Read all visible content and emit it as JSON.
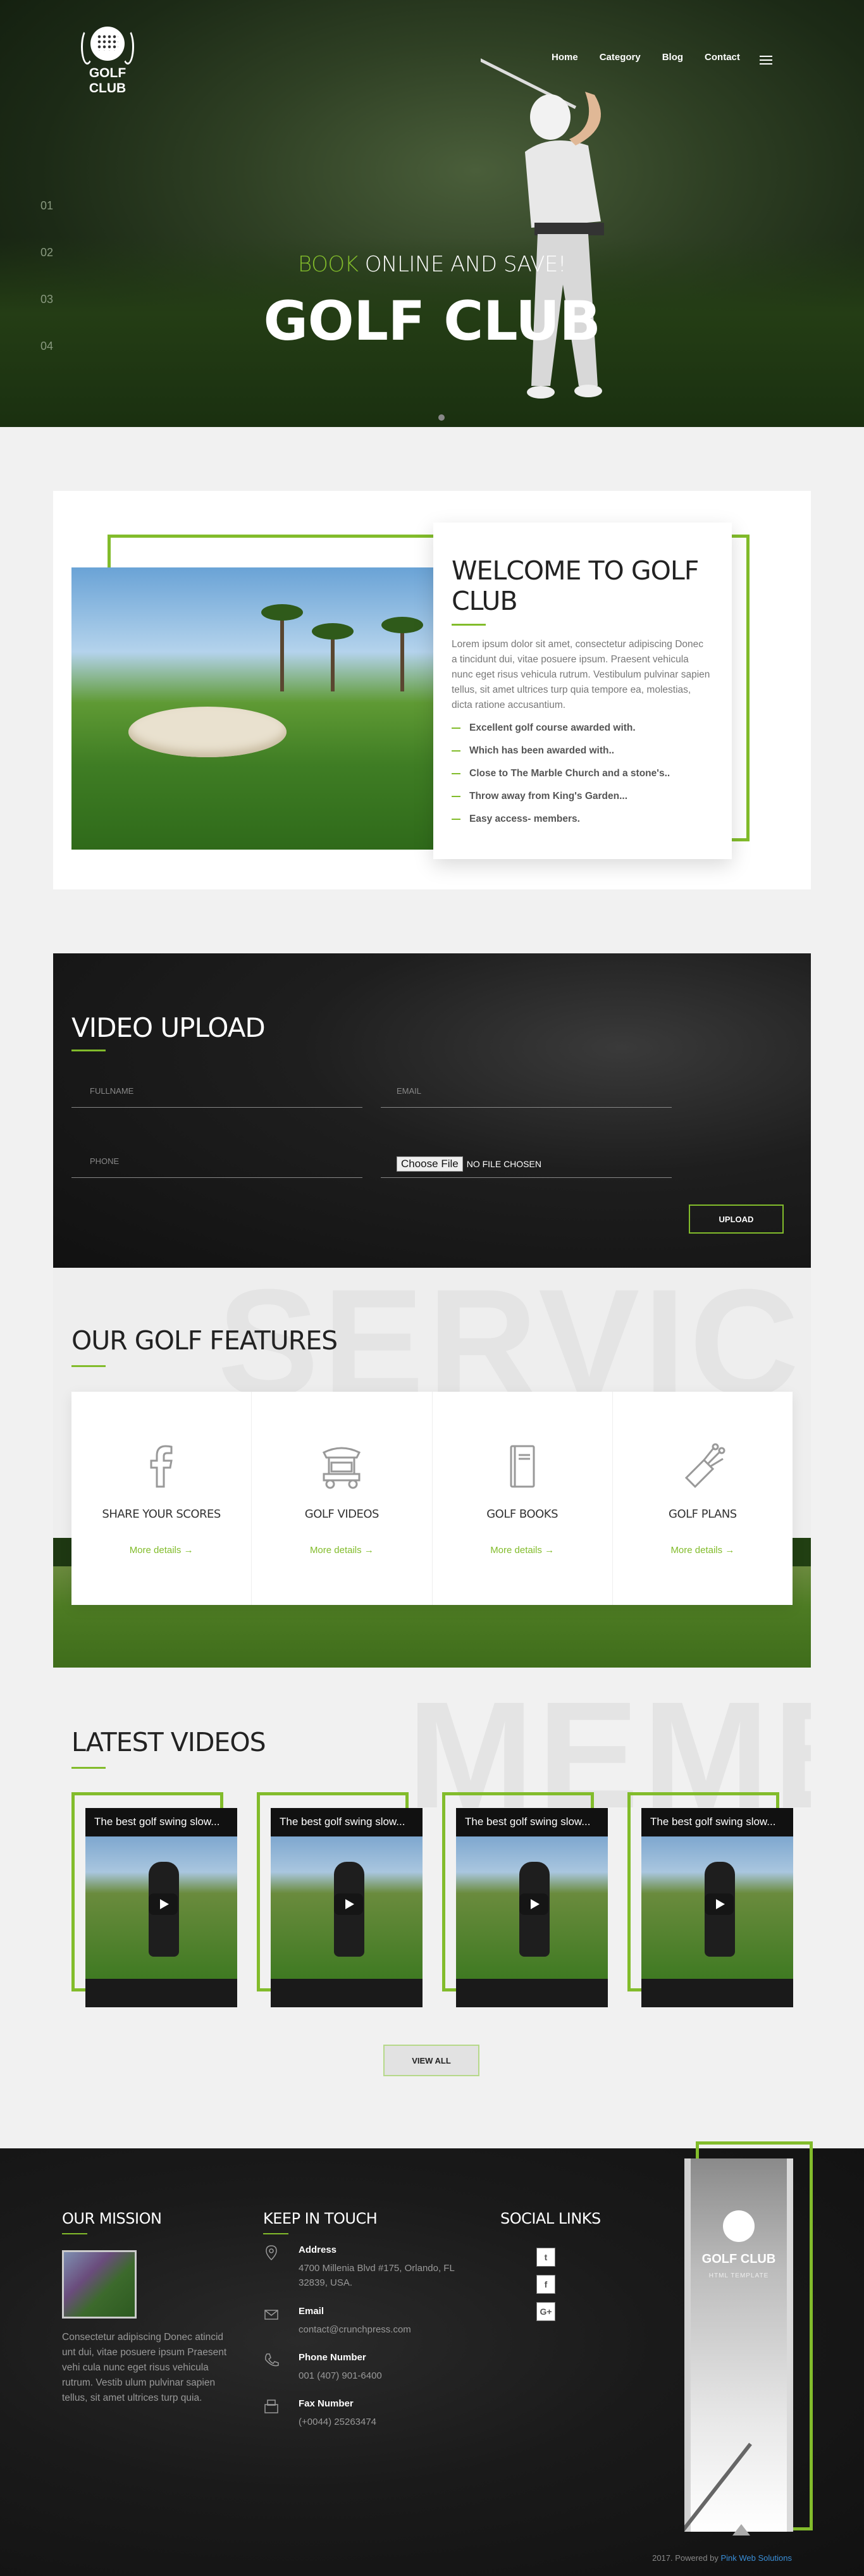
{
  "header": {
    "logo_text": "GOLF CLUB",
    "nav": [
      "Home",
      "Category",
      "Blog",
      "Contact"
    ]
  },
  "hero": {
    "slide_numbers": [
      "01",
      "02",
      "03",
      "04"
    ],
    "subtitle_accent": "BOOK",
    "subtitle_rest": " ONLINE AND SAVE!",
    "title": "GOLF CLUB"
  },
  "welcome": {
    "title": "WELCOME TO GOLF CLUB",
    "body": "Lorem ipsum dolor sit amet, consectetur adipiscing Donec a tincidunt dui, vitae posuere ipsum. Praesent vehicula nunc eget risus vehicula rutrum. Vestibulum pulvinar sapien tellus, sit amet ultrices turp quia tempore ea, molestias, dicta ratione accusantium.",
    "items": [
      "Excellent golf course awarded with.",
      "Which has been awarded with..",
      "Close to The Marble Church and a stone's..",
      "Throw away from King's Garden...",
      "Easy access- members."
    ]
  },
  "upload": {
    "title": "VIDEO UPLOAD",
    "fullname_placeholder": "FULLNAME",
    "email_placeholder": "EMAIL",
    "phone_placeholder": "PHONE",
    "file_button": "Choose File",
    "file_status": "NO FILE CHOSEN",
    "submit": "UPLOAD"
  },
  "features": {
    "title": "OUR GOLF FEATURES",
    "watermark": "SERVICE",
    "items": [
      {
        "icon": "facebook-icon",
        "title": "SHARE YOUR SCORES",
        "link": "More details"
      },
      {
        "icon": "golf-cart-icon",
        "title": "GOLF VIDEOS",
        "link": "More details"
      },
      {
        "icon": "book-icon",
        "title": "GOLF BOOKS",
        "link": "More details"
      },
      {
        "icon": "golf-bag-icon",
        "title": "GOLF PLANS",
        "link": "More details"
      }
    ]
  },
  "videos": {
    "title": "LATEST VIDEOS",
    "watermark": "MEMB",
    "items": [
      {
        "caption": "The best golf swing slow..."
      },
      {
        "caption": "The best golf swing slow..."
      },
      {
        "caption": "The best golf swing slow..."
      },
      {
        "caption": "The best golf swing slow..."
      }
    ],
    "view_all": "VIEW ALL"
  },
  "footer": {
    "mission_title": "OUR MISSION",
    "mission_text": "Consectetur adipiscing Donec atincid unt dui, vitae posuere ipsum Praesent vehi cula nunc eget risus vehicula rutrum. Vestib ulum pulvinar sapien tellus, sit amet ultrices turp quia.",
    "contact_title": "KEEP IN TOUCH",
    "contact": [
      {
        "label": "Address",
        "value": "4700 Millenia Blvd #175, Orlando, FL 32839, USA."
      },
      {
        "label": "Email",
        "value": "contact@crunchpress.com"
      },
      {
        "label": "Phone Number",
        "value": "001 (407) 901-6400"
      },
      {
        "label": "Fax Number",
        "value": "(+0044) 25263474"
      }
    ],
    "social_title": "SOCIAL LINKS",
    "social": [
      "twitter-icon",
      "facebook-icon",
      "google-plus-icon"
    ],
    "banner_name": "GOLF CLUB",
    "banner_sub": "HTML TEMPLATE",
    "copyright_prefix": "2017. Powered by ",
    "copyright_link": "Pink Web Solutions"
  },
  "colors": {
    "accent": "#82bc2b",
    "dark": "#111111",
    "link": "#3a8fd8"
  }
}
